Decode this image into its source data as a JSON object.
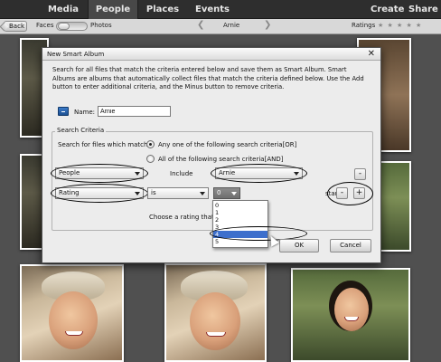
{
  "nav": {
    "tabs": [
      "Media",
      "People",
      "Places",
      "Events"
    ],
    "active_tab": "People",
    "right": [
      "Create",
      "Share"
    ]
  },
  "subbar": {
    "back_label": "Back",
    "faces_label": "Faces",
    "photos_label": "Photos",
    "person_name": "Arnie",
    "ratings_label": "Ratings",
    "stars": "★ ★ ★ ★ ★"
  },
  "dialog": {
    "title": "New Smart Album",
    "close_glyph": "✕",
    "description": "Search for all files that match the criteria entered below and save them as Smart Album. Smart Albums are albums that automatically collect files that match the criteria defined below. Use the Add button to enter additional criteria, and the Minus button to remove criteria.",
    "name_label": "Name:",
    "name_value": "Arnie",
    "group_title": "Search Criteria",
    "match_label": "Search for files which match:",
    "radio_any": "Any one of the following search criteria[OR]",
    "radio_all": "All of the following search criteria[AND]",
    "row1": {
      "field": "People",
      "operator": "Include",
      "value": "Arnie"
    },
    "row2": {
      "field": "Rating",
      "operator": "is",
      "value": "0",
      "suffix": "stars"
    },
    "minus_glyph": "-",
    "plus_glyph": "+",
    "hint": "Choose a rating that is",
    "rating_options": [
      "0",
      "1",
      "2",
      "3",
      "4",
      "5"
    ],
    "rating_selected": "4",
    "ok_label": "OK",
    "cancel_label": "Cancel"
  }
}
